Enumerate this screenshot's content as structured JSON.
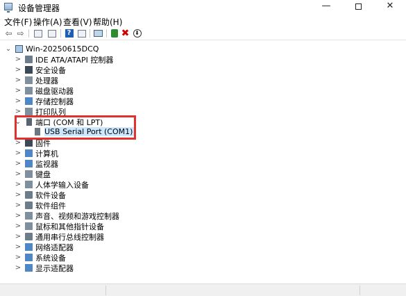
{
  "window": {
    "title": "设备管理器",
    "minimize": "—",
    "close": "✕"
  },
  "menu": [
    "文件(F)",
    "操作(A)",
    "查看(V)",
    "帮助(H)"
  ],
  "toolbar": {
    "back": "⇦",
    "forward": "⇨",
    "help": "?",
    "uninstall": "✖",
    "download": "⬇"
  },
  "tree": {
    "root": "Win-20250615DCQ",
    "expander_collapsed": ">",
    "expander_expanded": "⌄",
    "expander_root": "⌄",
    "categories": [
      {
        "label": "IDE ATA/ATAPI 控制器",
        "icon": "ide-controller-icon"
      },
      {
        "label": "安全设备",
        "icon": "security-device-icon"
      },
      {
        "label": "处理器",
        "icon": "processor-icon"
      },
      {
        "label": "磁盘驱动器",
        "icon": "disk-drive-icon"
      },
      {
        "label": "存储控制器",
        "icon": "storage-controller-icon"
      },
      {
        "label": "打印队列",
        "icon": "print-queue-icon"
      },
      {
        "label": "端口 (COM 和 LPT)",
        "icon": "port-icon"
      },
      {
        "label": "固件",
        "icon": "firmware-icon"
      },
      {
        "label": "计算机",
        "icon": "computer-icon"
      },
      {
        "label": "监视器",
        "icon": "monitor-icon"
      },
      {
        "label": "键盘",
        "icon": "keyboard-icon"
      },
      {
        "label": "人体学输入设备",
        "icon": "hid-icon"
      },
      {
        "label": "软件设备",
        "icon": "software-device-icon"
      },
      {
        "label": "软件组件",
        "icon": "software-component-icon"
      },
      {
        "label": "声音、视频和游戏控制器",
        "icon": "sound-icon"
      },
      {
        "label": "鼠标和其他指针设备",
        "icon": "mouse-icon"
      },
      {
        "label": "通用串行总线控制器",
        "icon": "usb-icon"
      },
      {
        "label": "网络适配器",
        "icon": "network-adapter-icon"
      },
      {
        "label": "系统设备",
        "icon": "system-device-icon"
      },
      {
        "label": "显示适配器",
        "icon": "display-adapter-icon"
      }
    ],
    "port_child": "USB Serial Port (COM1)"
  },
  "colors": {
    "highlight_border": "#e0312f",
    "selection": "#cce8ff"
  }
}
